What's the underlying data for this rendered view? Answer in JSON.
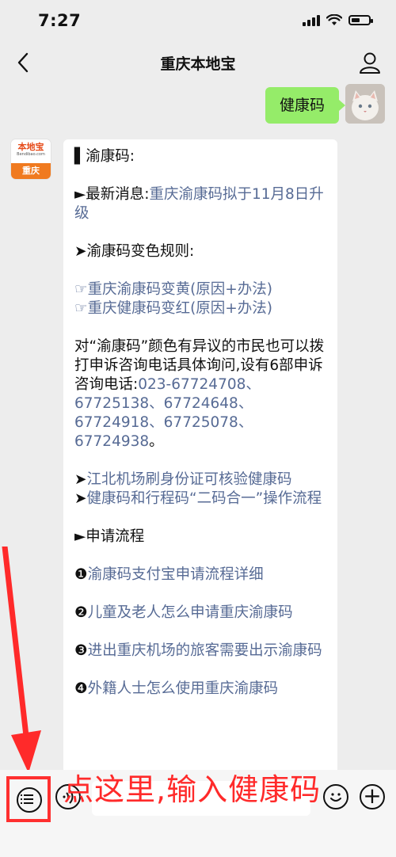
{
  "status_bar": {
    "time": "7:27"
  },
  "nav": {
    "title": "重庆本地宝"
  },
  "outgoing": {
    "text": "健康码"
  },
  "bot_avatar": {
    "brand": "本地宝",
    "url": "Bendibao.com",
    "city": "重庆"
  },
  "message": {
    "header": "▌渝康码:",
    "news_prefix": "►最新消息:",
    "news_link": "重庆渝康码拟于11月8日升级",
    "rules_title": "➤渝康码变色规则:",
    "rule_links": [
      "☞重庆渝康码变黄(原因+办法)",
      "☞重庆健康码变红(原因+办法)"
    ],
    "complaint_text": "对“渝康码”颜色有异议的市民也可以拨打申诉咨询电话具体询问,设有6部申诉咨询电话:",
    "complaint_phones": "023-67724708、67725138、67724648、67724918、67725078、67724938",
    "complaint_end": "。",
    "airport_prefix": "➤",
    "airport_link": "江北机场刷身份证可核验健康码",
    "merge_prefix": "➤",
    "merge_link": "健康码和行程码“二码合一”操作流程",
    "apply_title": "►申请流程",
    "steps": [
      {
        "num": "❶",
        "text": "渝康码支付宝申请流程详细"
      },
      {
        "num": "❷",
        "text": "儿童及老人怎么申请重庆渝康码"
      },
      {
        "num": "❸",
        "text": "进出重庆机场的旅客需要出示渝康码"
      },
      {
        "num": "❹",
        "text": "外籍人士怎么使用重庆渝康码"
      }
    ]
  },
  "annotation": {
    "text": "点这里,输入健康码",
    "color": "#ff2a2a"
  },
  "colors": {
    "link": "#576b95",
    "outgoing_bubble": "#95ec69",
    "background": "#ededed"
  },
  "icons": [
    "back-chevron-icon",
    "user-icon",
    "menu-list-icon",
    "voice-icon",
    "emoji-icon",
    "plus-icon"
  ]
}
